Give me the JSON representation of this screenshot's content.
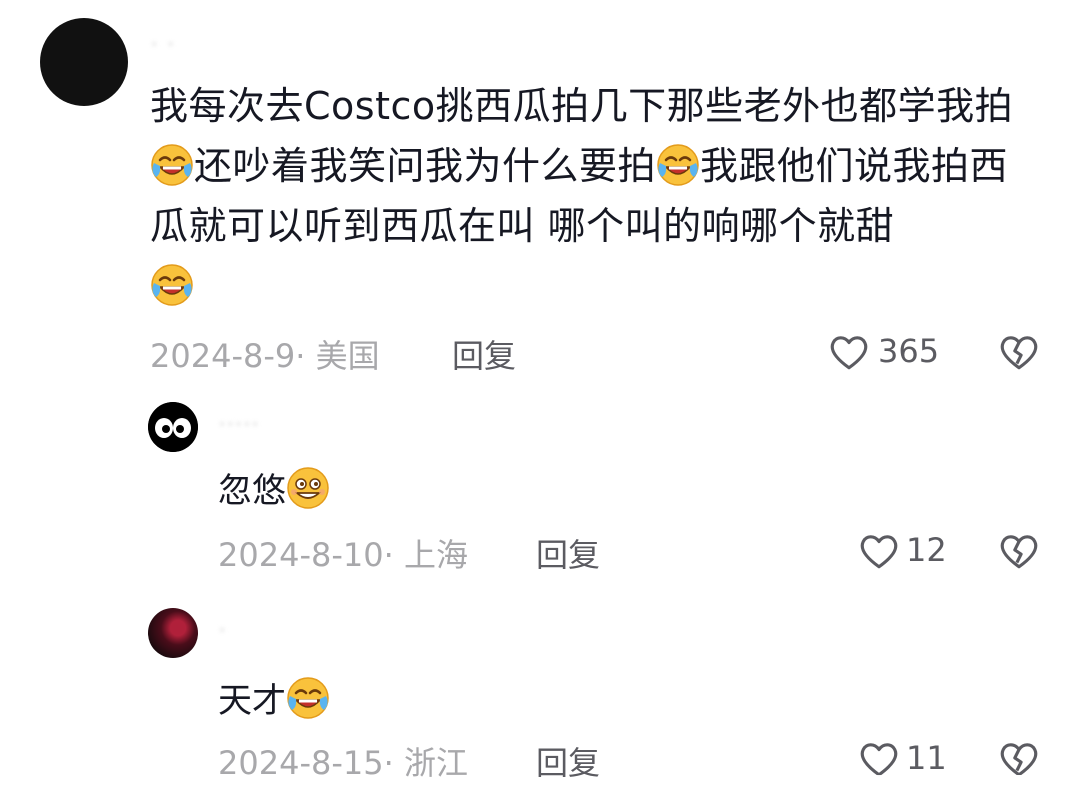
{
  "comment": {
    "text_parts": [
      "我每次去Costco挑西瓜拍几下那些老外也都学我拍",
      "还吵着我笑问我为什么要拍",
      "我跟他们说我拍西瓜就可以听到西瓜在叫 哪个叫的响哪个就甜"
    ],
    "emoji": "crying-laughing-emoji",
    "meta": "2024-8-9· 美国",
    "reply_label": "回复",
    "likes": "365"
  },
  "replies": [
    {
      "text": "忽悠",
      "emoji": "grinning-emoji",
      "meta": "2024-8-10· 上海",
      "reply_label": "回复",
      "likes": "12"
    },
    {
      "text": "天才",
      "emoji": "crying-laughing-emoji",
      "meta": "2024-8-15· 浙江",
      "reply_label": "回复",
      "likes": "11"
    }
  ],
  "colors": {
    "text": "#161823",
    "meta": "#a8a8ab",
    "action": "#5b5b61",
    "emoji_face": "#f7b928"
  }
}
